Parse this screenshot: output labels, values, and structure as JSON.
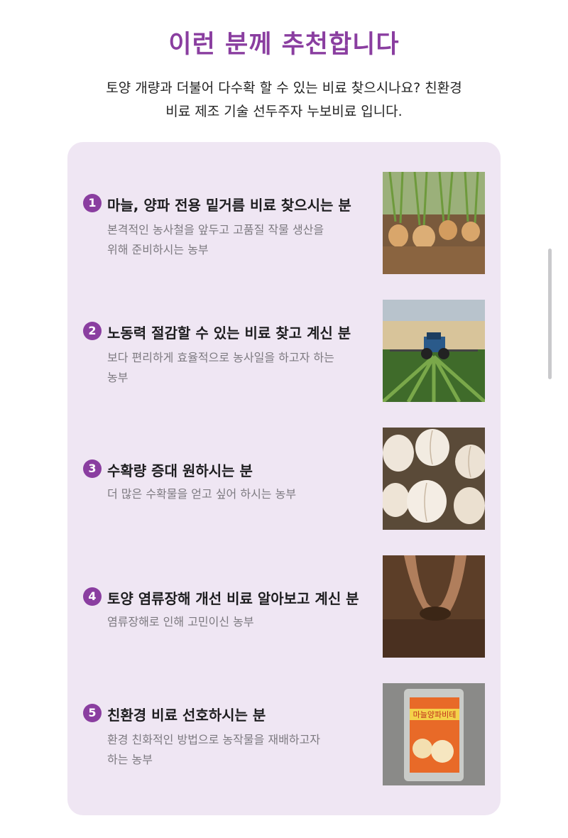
{
  "header": {
    "title": "이런 분께 추천합니다",
    "intro_line1": "토양 개량과 더불어 다수확 할 수 있는 비료 찾으시나요? 친환경",
    "intro_line2": "비료 제조 기술 선두주자 누보비료 입니다."
  },
  "items": [
    {
      "num": "1",
      "title": "마늘, 양파 전용 밑거름 비료 찾으시는 분",
      "desc1": "본격적인 농사철을 앞두고 고품질 작물 생산을",
      "desc2": "위해 준비하시는 농부",
      "image": "onion-field-photo"
    },
    {
      "num": "2",
      "title": "노동력 절감할 수 있는 비료 찾고 계신 분",
      "desc1": "보다 편리하게 효율적으로 농사일을 하고자 하는",
      "desc2": "농부",
      "image": "tractor-field-photo"
    },
    {
      "num": "3",
      "title": "수확량 증대 원하시는 분",
      "desc1": "더 많은 수확물을 얻고 싶어 하시는 농부",
      "desc2": "",
      "image": "garlic-harvest-photo"
    },
    {
      "num": "4",
      "title": "토양 염류장해 개선 비료 알아보고 계신 분",
      "desc1": "염류장해로 인해 고민이신 농부",
      "desc2": "",
      "image": "hands-soil-photo"
    },
    {
      "num": "5",
      "title": "친환경 비료 선호하시는 분",
      "desc1": "환경 친화적인 방법으로 농작물을 재배하고자",
      "desc2": "하는 농부",
      "image": "fertilizer-bag-photo",
      "package_text": "마늘양파비테"
    }
  ],
  "colors": {
    "accent": "#8a3ea0",
    "card_bg": "#efe6f3",
    "desc_text": "#7d7a80"
  }
}
